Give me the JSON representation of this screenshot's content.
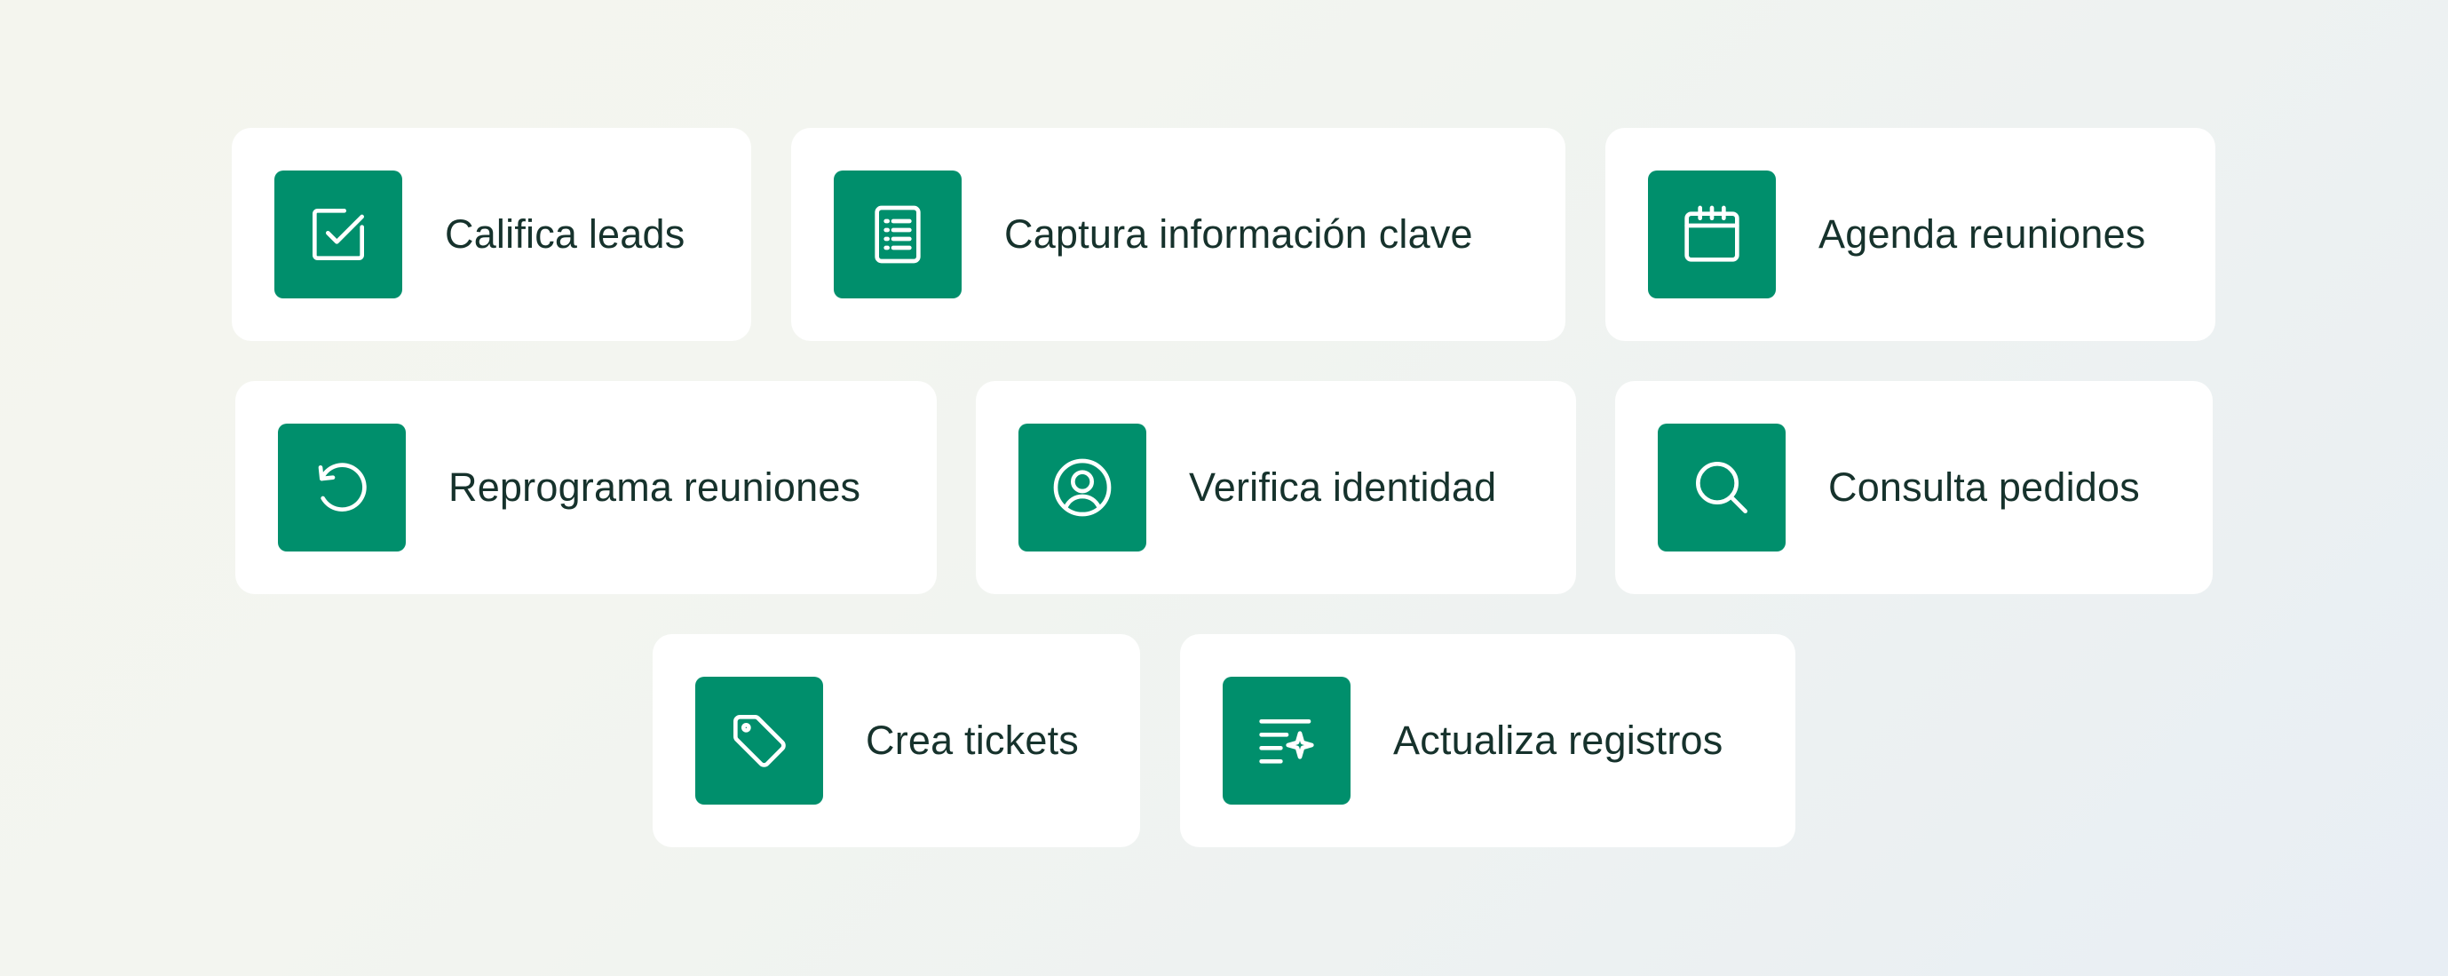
{
  "colors": {
    "icon_background": "#008f6c",
    "card_background": "#ffffff",
    "text": "#16322c"
  },
  "cards": [
    {
      "label": "Califica leads",
      "icon": "checkbox-icon"
    },
    {
      "label": "Captura información clave",
      "icon": "document-list-icon"
    },
    {
      "label": "Agenda reuniones",
      "icon": "calendar-icon"
    },
    {
      "label": "Reprograma reuniones",
      "icon": "refresh-icon"
    },
    {
      "label": "Verifica identidad",
      "icon": "user-circle-icon"
    },
    {
      "label": "Consulta pedidos",
      "icon": "search-icon"
    },
    {
      "label": "Crea tickets",
      "icon": "tag-icon"
    },
    {
      "label": "Actualiza registros",
      "icon": "sparkle-lines-icon"
    }
  ]
}
